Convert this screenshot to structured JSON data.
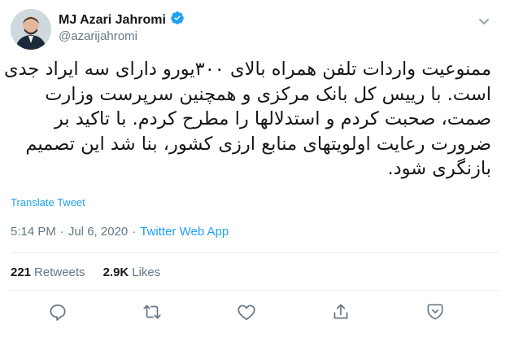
{
  "author": {
    "name": "MJ Azari Jahromi",
    "handle": "@azarijahromi",
    "verified": true
  },
  "tweet": {
    "text": "ممنوعیت واردات تلفن همراه بالای ۳۰۰یورو دارای سه ایراد جدی است. با رییس کل بانک مرکزی و همچنین سرپرست وزارت صمت، صحبت کردم و استدلالها را مطرح کردم. با تاکید بر ضرورت رعایت اولویتهای منابع ارزی کشور، بنا شد این تصمیم بازنگری شود.",
    "translate_label": "Translate Tweet",
    "time": "5:14 PM",
    "separator": "·",
    "date": "Jul 6, 2020",
    "source": "Twitter Web App"
  },
  "stats": {
    "retweets_count": "221",
    "retweets_label": "Retweets",
    "likes_count": "2.9K",
    "likes_label": "Likes"
  },
  "colors": {
    "accent": "#1da1f2",
    "secondary_text": "#657786",
    "divider": "#e6ecf0"
  },
  "icons": [
    "verified-icon",
    "caret-down-icon",
    "reply-icon",
    "retweet-icon",
    "like-icon",
    "share-icon",
    "analytics-icon"
  ]
}
